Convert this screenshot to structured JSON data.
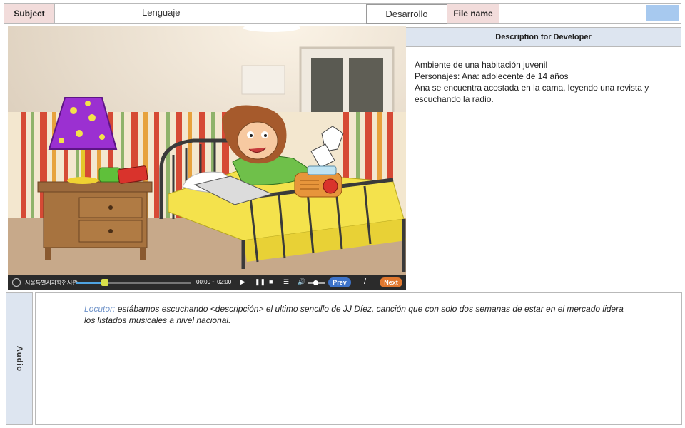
{
  "header": {
    "subject_label": "Subject",
    "subject_value": "Lenguaje",
    "stage_value": "Desarrollo",
    "filename_label": "File name",
    "filename_value": ""
  },
  "player": {
    "logo_text": "서울특별시과학전시관",
    "time": "00:00 ~ 02:00",
    "progress": 0.25,
    "prev_label": "Prev",
    "separator": "/",
    "next_label": "Next"
  },
  "description": {
    "title": "Description for Developer",
    "lines": [
      "Ambiente de una habitación juvenil",
      "Personajes: Ana: adolecente de 14 años",
      "Ana se encuentra acostada en la cama, leyendo una revista y escuchando la radio."
    ]
  },
  "audio": {
    "label": "Audio",
    "speaker": "Locutor:",
    "text": " estábamos escuchando <descripción> el ultimo sencillo de JJ Díez,  canción que con solo dos semanas de estar en el mercado lidera los listados musicales a nivel nacional."
  },
  "colors": {
    "label_bg": "#f2dcdb",
    "panel_head_bg": "#dde5f0",
    "swatch": "#a7c9ef",
    "speaker": "#6f93c9",
    "player_bg": "#2b2b2b",
    "prev_button": "#3d73c9",
    "next_button": "#e0782f"
  }
}
